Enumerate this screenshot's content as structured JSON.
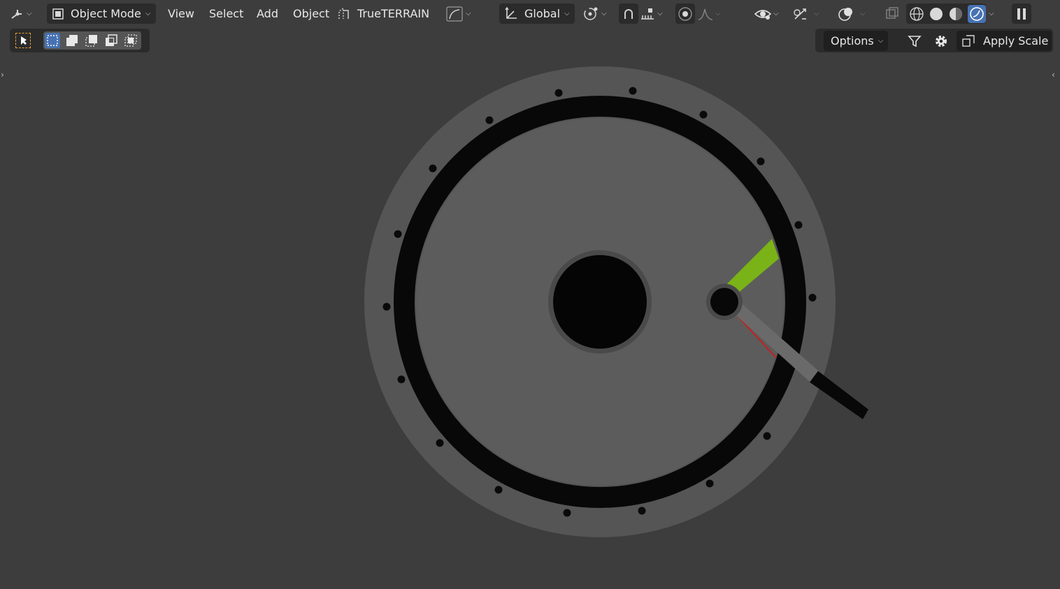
{
  "header": {
    "mode_label": "Object Mode",
    "menus": [
      "View",
      "Select",
      "Add",
      "Object"
    ],
    "addon_label": "TrueTERRAIN",
    "transform_orientation": "Global"
  },
  "toolbar2": {
    "options_label": "Options",
    "apply_scale_label": "Apply Scale"
  },
  "icons": {
    "editor_type": "editor-type-icon",
    "mode": "object-mode-icon",
    "addon": "trueterrain-icon",
    "curve": "curve-icon",
    "orientation": "transform-orientation-icon",
    "pivot": "pivot-icon",
    "snap": "snap-icon",
    "proportional": "proportional-editing-icon",
    "visibility": "eye-icon",
    "gizmo": "gizmo-icon",
    "overlay": "overlay-icon",
    "xray": "xray-icon",
    "shading_wire": "wireframe-shading-icon",
    "shading_solid": "solid-shading-icon",
    "shading_material": "material-shading-icon",
    "shading_rendered": "rendered-shading-icon",
    "pause": "pause-icon",
    "filter": "filter-icon",
    "gear": "gear-icon",
    "apply_scale": "apply-scale-icon"
  },
  "colors": {
    "viewport_bg": "#3d3d3d",
    "header_bg": "#2b2b2b",
    "accent_blue": "#4772b3",
    "select_orange": "#e8a032",
    "green_part": "#7cb518",
    "red_line": "#d62020"
  }
}
